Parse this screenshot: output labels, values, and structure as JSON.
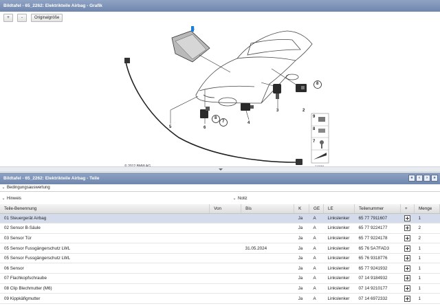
{
  "graphic_panel": {
    "title": "Bildtafel - 65_2262: Elektrikteile Airbag - Grafik",
    "toolbar": {
      "zoom_in": "+",
      "zoom_out": "-",
      "original_size": "Originalgröße"
    },
    "copyright": "© 2012 BMW AG",
    "image_id": "215084",
    "callouts": [
      "1",
      "2",
      "3",
      "4",
      "5",
      "6",
      "7",
      "8",
      "8",
      "9"
    ],
    "side_panel_numbers": [
      "9",
      "8",
      "7"
    ]
  },
  "parts_panel": {
    "title": "Bildtafel - 65_2262: Elektrikteile Airbag - Teile",
    "nav_buttons": [
      "«",
      "‹",
      "›",
      "»"
    ],
    "sections": {
      "conditions": "Bedingungsauswertung",
      "notes": "Hinweis",
      "notice": "Notiz"
    },
    "columns": [
      "Teile-Benennung",
      "Von",
      "Bis",
      "K",
      "GE",
      "LE",
      "Teilenummer",
      "+",
      "Menge"
    ],
    "rows": [
      {
        "name": "01 Steuergerät Airbag",
        "von": "",
        "bis": "",
        "k": "Ja",
        "ge": "A",
        "le": "Linkslenker",
        "nr": "65 77 7911607",
        "qty": "1",
        "selected": true
      },
      {
        "name": "02 Sensor B-Säule",
        "von": "",
        "bis": "",
        "k": "Ja",
        "ge": "A",
        "le": "Linkslenker",
        "nr": "65 77 9224177",
        "qty": "2",
        "selected": false
      },
      {
        "name": "03 Sensor Tür",
        "von": "",
        "bis": "",
        "k": "Ja",
        "ge": "A",
        "le": "Linkslenker",
        "nr": "65 77 9224178",
        "qty": "2",
        "selected": false
      },
      {
        "name": "05 Sensor Fussgängerschutz LWL",
        "von": "",
        "bis": "31.05.2024",
        "k": "Ja",
        "ge": "A",
        "le": "Linkslenker",
        "nr": "65 76 5A7FAD3",
        "qty": "1",
        "selected": false
      },
      {
        "name": "05 Sensor Fussgängerschutz LWL",
        "von": "",
        "bis": "",
        "k": "Ja",
        "ge": "A",
        "le": "Linkslenker",
        "nr": "65 76 9318776",
        "qty": "1",
        "selected": false
      },
      {
        "name": "06 Sensor",
        "von": "",
        "bis": "",
        "k": "Ja",
        "ge": "A",
        "le": "Linkslenker",
        "nr": "65 77 9241932",
        "qty": "1",
        "selected": false
      },
      {
        "name": "07 Flachkopfschraube",
        "von": "",
        "bis": "",
        "k": "Ja",
        "ge": "A",
        "le": "Linkslenker",
        "nr": "07 14 9184932",
        "qty": "1",
        "selected": false
      },
      {
        "name": "08 Clip Blechmutter (M6)",
        "von": "",
        "bis": "",
        "k": "Ja",
        "ge": "A",
        "le": "Linkslenker",
        "nr": "07 14 9210177",
        "qty": "1",
        "selected": false
      },
      {
        "name": "09 Kippkäfigmutter",
        "von": "",
        "bis": "",
        "k": "Ja",
        "ge": "A",
        "le": "Linkslenker",
        "nr": "07 14 6972332",
        "qty": "1",
        "selected": false
      }
    ]
  },
  "colors": {
    "titlebar": "#7b91b6",
    "selected_row": "#d4dcec",
    "accent": "#1a7fd4"
  }
}
